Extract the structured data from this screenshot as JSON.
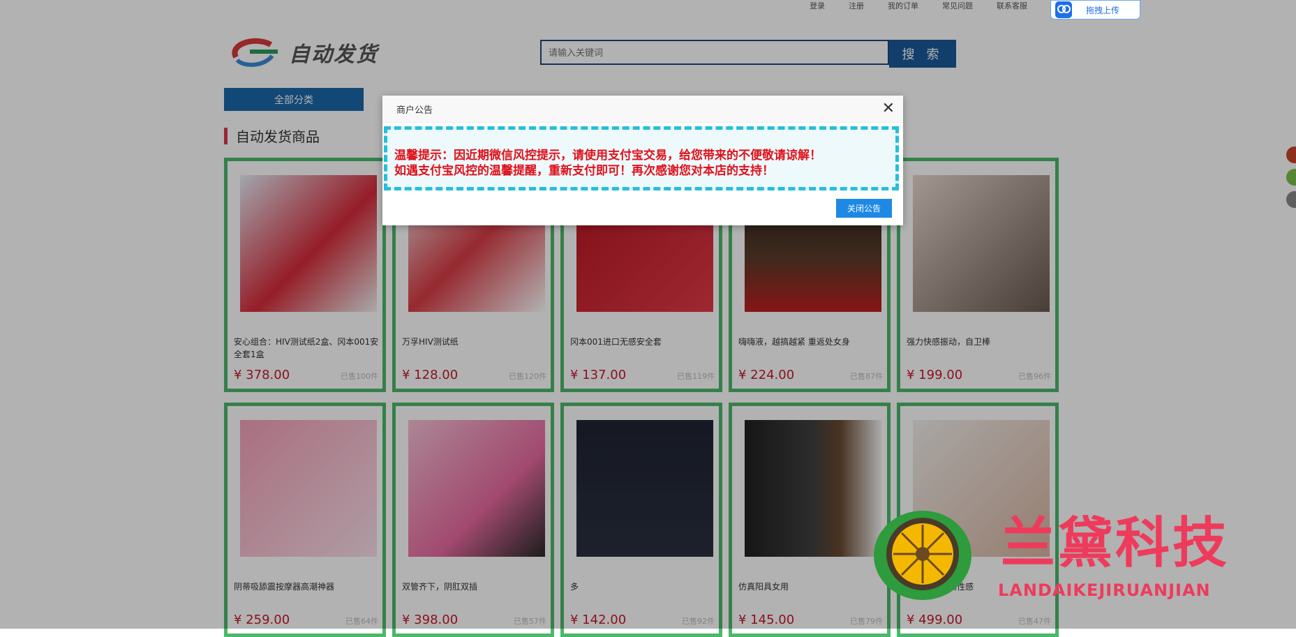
{
  "top_links": [
    "登录",
    "注册",
    "我的订单",
    "常见问题",
    "联系客服"
  ],
  "upload_chip": {
    "label": "拖拽上传"
  },
  "logo": {
    "text": "自动发货"
  },
  "search": {
    "placeholder": "请输入关键词",
    "button": "搜 索"
  },
  "category_button": "全部分类",
  "section_title": "自动发货商品",
  "products": [
    {
      "name": "安心组合：HIV测试纸2盒、冈本001安全套1盒",
      "price": "¥ 378.00",
      "sold": "已售100件"
    },
    {
      "name": "万孚HIV测试纸",
      "price": "¥ 128.00",
      "sold": "已售120件"
    },
    {
      "name": "冈本001进口无感安全套",
      "price": "¥ 137.00",
      "sold": "已售119件"
    },
    {
      "name": "嗨嗨液，越搞越紧 重返处女身",
      "price": "¥ 224.00",
      "sold": "已售87件"
    },
    {
      "name": "强力快感振动，自卫棒",
      "price": "¥ 199.00",
      "sold": "已售96件"
    },
    {
      "name": "阴蒂吸舔震按摩器高潮神器",
      "price": "¥ 259.00",
      "sold": "已售64件"
    },
    {
      "name": "双管齐下，阴肛双插",
      "price": "¥ 398.00",
      "sold": "已售57件"
    },
    {
      "name": "多",
      "price": "¥ 142.00",
      "sold": "已售92件"
    },
    {
      "name": "仿真阳具女用",
      "price": "¥ 145.00",
      "sold": "已售79件"
    },
    {
      "name": "高端阳具写真性感",
      "price": "¥ 499.00",
      "sold": "已售47件"
    }
  ],
  "modal": {
    "title": "商户公告",
    "close_icon": "close-icon",
    "line1": "温馨提示：因近期微信风控提示，请使用支付宝交易，给您带来的不便敬请谅解！",
    "line2": "如遇支付宝风控的温馨提醒，重新支付即可！再次感谢您对本店的支持！",
    "button": "关闭公告"
  },
  "watermark": {
    "title": "兰黛科技",
    "subtitle": "LANDAIKEJIRUANJIAN"
  },
  "colors": {
    "accent": "#1e88e5",
    "notice_text": "#e0101a",
    "card_border": "#4bb86a",
    "price": "#c4192b"
  }
}
